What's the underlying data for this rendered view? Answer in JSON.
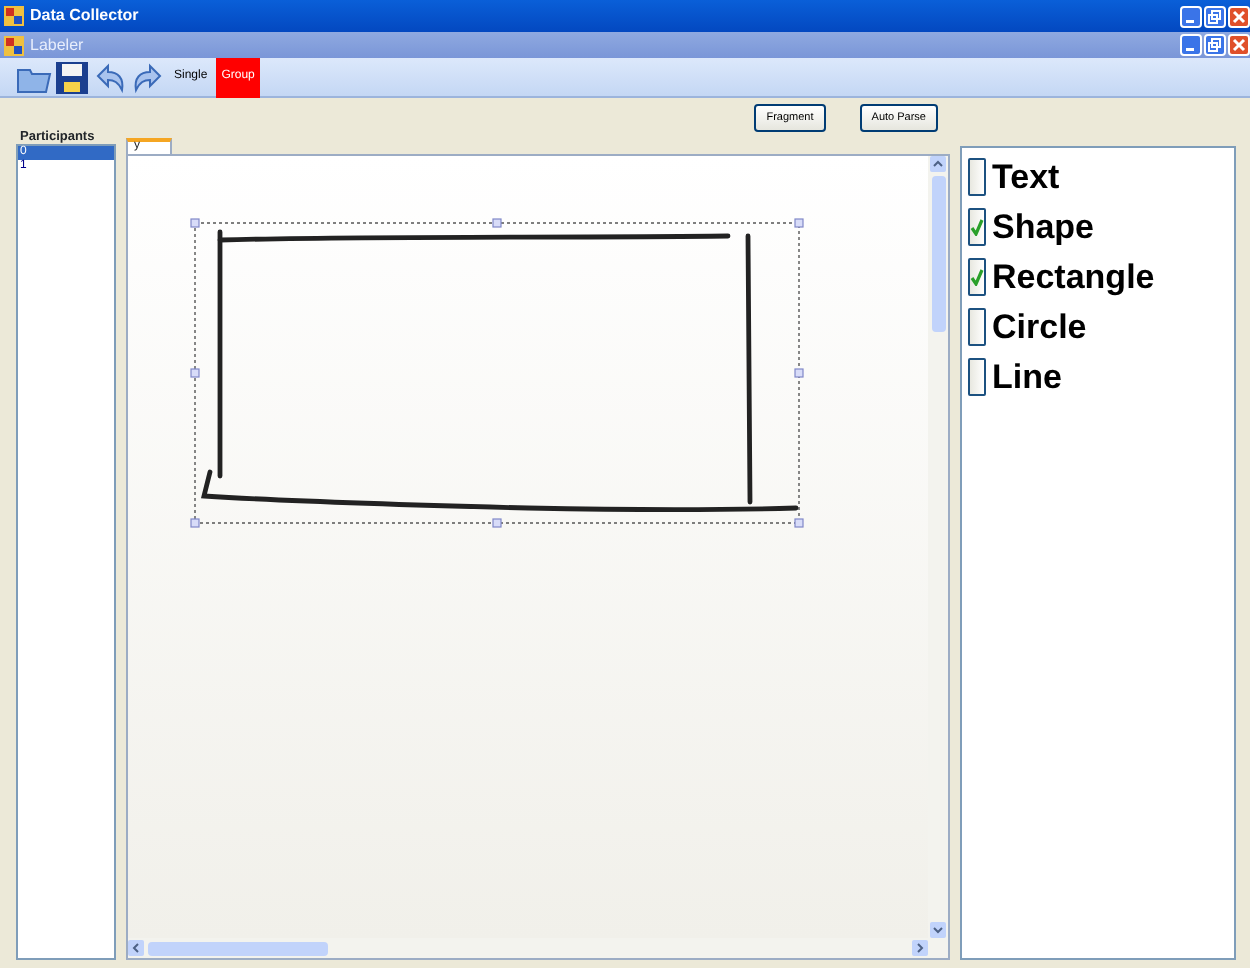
{
  "window": {
    "title": "Data Collector"
  },
  "child_window": {
    "title": "Labeler"
  },
  "toolbar": {
    "modes": [
      {
        "label": "Single",
        "selected": false
      },
      {
        "label": "Group",
        "selected": true
      }
    ]
  },
  "participants": {
    "title": "Participants",
    "items": [
      {
        "label": "0",
        "selected": true
      },
      {
        "label": "1",
        "selected": false
      }
    ]
  },
  "buttons": [
    "Fragment",
    "Auto Parse"
  ],
  "tabs": [
    {
      "label": "y",
      "selected": true
    }
  ],
  "labels": [
    {
      "label": "Text",
      "checked": false
    },
    {
      "label": "Shape",
      "checked": true
    },
    {
      "label": "Rectangle",
      "checked": true
    },
    {
      "label": "Circle",
      "checked": false
    },
    {
      "label": "Line",
      "checked": false
    }
  ]
}
